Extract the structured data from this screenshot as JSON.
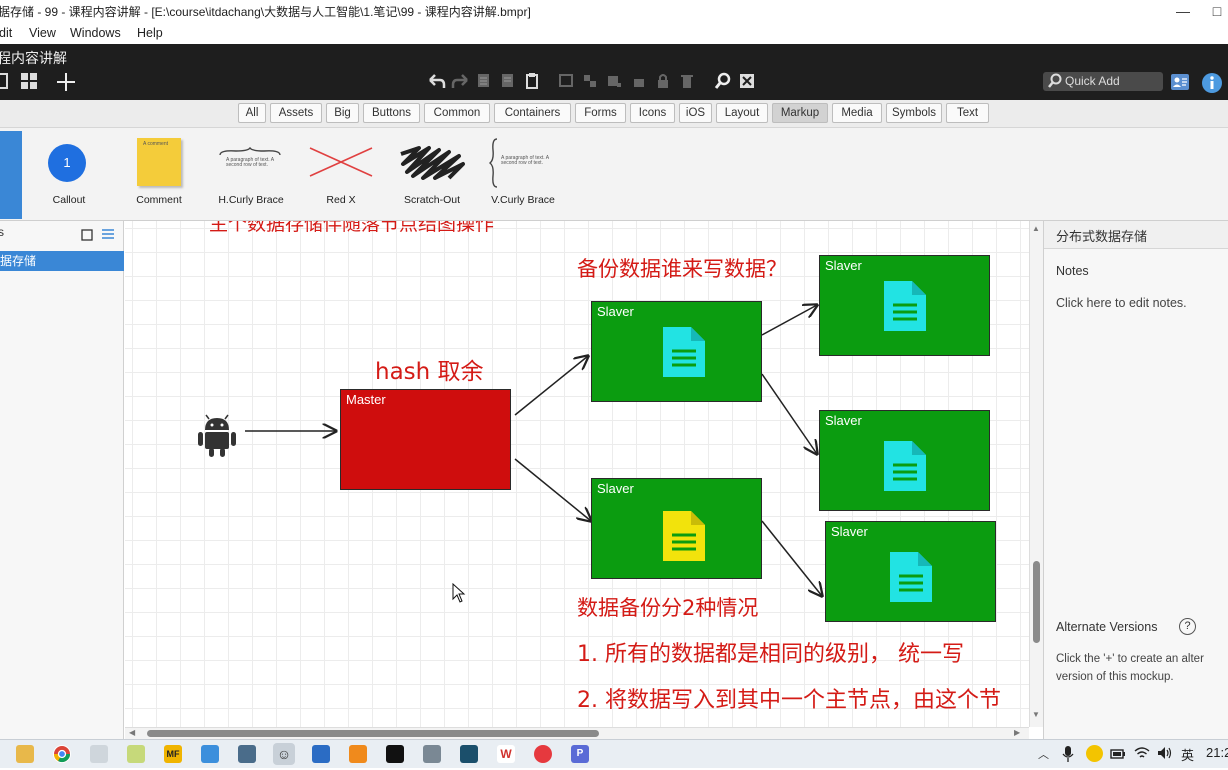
{
  "window": {
    "title": "据存储 - 99 - 课程内容讲解 - [E:\\course\\itdachang\\大数据与人工智能\\1.笔记\\99 - 课程内容讲解.bmpr]",
    "minimize_glyph": "—",
    "maximize_glyph": "□"
  },
  "menu": [
    "dit",
    "View",
    "Windows",
    "Help"
  ],
  "toolbar": {
    "doc_title": "程内容讲解",
    "quick_add_placeholder": "Quick Add",
    "icons": [
      "view-toggle-icon",
      "grid-icon",
      "add-icon",
      "undo-icon",
      "redo-icon",
      "copy-icon",
      "paste-icon",
      "clipboard-icon",
      "group-icon",
      "ungroup-icon",
      "align-icon",
      "lock-icon",
      "delete-icon",
      "search-icon",
      "close-icon",
      "search-icon",
      "user-icon",
      "info-icon"
    ]
  },
  "filters": {
    "tabs": [
      "All",
      "Assets",
      "Big",
      "Buttons",
      "Common",
      "Containers",
      "Forms",
      "Icons",
      "iOS",
      "Layout",
      "Markup",
      "Media",
      "Symbols",
      "Text"
    ],
    "selected": "Markup"
  },
  "library": {
    "items": [
      {
        "label": "Callout",
        "badge": "1"
      },
      {
        "label": "Comment",
        "preview_text": "A comment"
      },
      {
        "label": "H.Curly Brace",
        "preview_text": "A paragraph of text. A second row of text."
      },
      {
        "label": "Red X"
      },
      {
        "label": "Scratch-Out"
      },
      {
        "label": "V.Curly Brace",
        "preview_text": "A paragraph of text. A second row of text."
      }
    ]
  },
  "left_panel": {
    "selected_item": "据存储",
    "partial_char": "s"
  },
  "canvas": {
    "annotations": {
      "top_cut": "主个数据存储伴随落节点结图操作",
      "who_writes": "备份数据谁来写数据？",
      "hash": "hash 取余",
      "backup_cases": "数据备份分2种情况",
      "case1": "1. 所有的数据都是相同的级别， 统一写",
      "case2": "2. 将数据写入到其中一个主节点，由这个节"
    },
    "nodes": {
      "master": "Master",
      "slaver": "Slaver"
    },
    "colors": {
      "annotation": "#d41b16",
      "slaver_green": "#0b9c10",
      "master_red": "#cf0d0d",
      "doc_cyan": "#22e3e3",
      "doc_yellow": "#f2e30c"
    }
  },
  "right_panel": {
    "page_title": "分布式数据存储",
    "notes_label": "Notes",
    "notes_hint": "Click here to edit notes.",
    "alt_versions_label": "Alternate Versions",
    "alt_versions_help": "?",
    "alt_versions_hint_1": "Click the '+' to create an alter",
    "alt_versions_hint_2": "version of this mockup."
  },
  "taskbar": {
    "ime": "英",
    "clock": "21:2"
  }
}
